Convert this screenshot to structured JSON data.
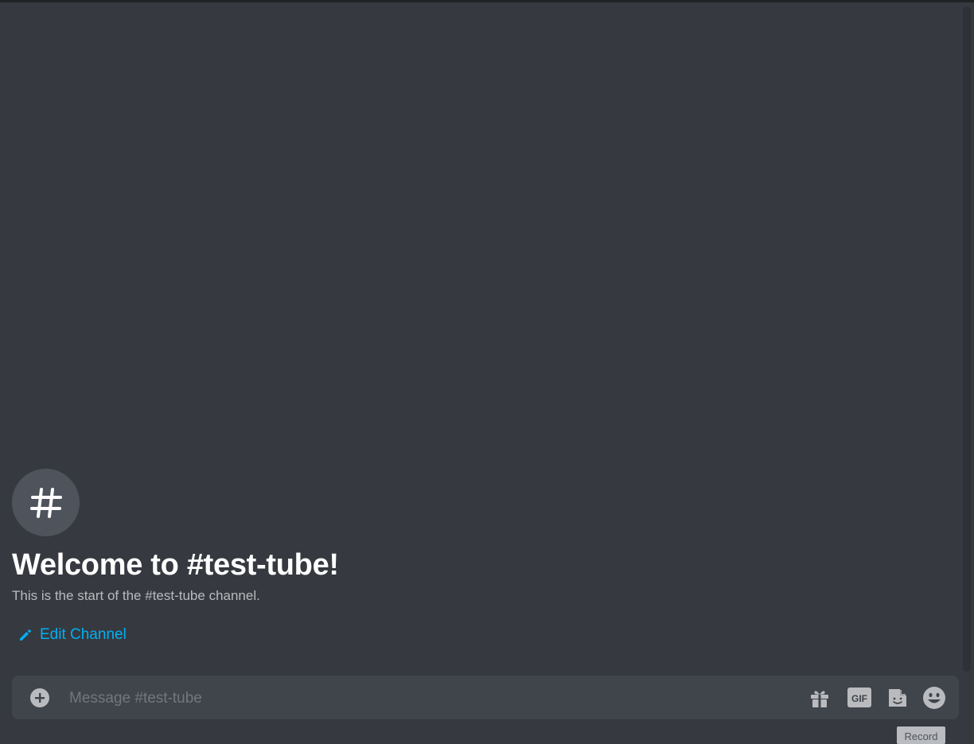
{
  "channel": {
    "name": "#test-tube",
    "welcome_title": "Welcome to #test-tube!",
    "welcome_subtitle": "This is the start of the #test-tube channel.",
    "edit_label": "Edit Channel"
  },
  "composer": {
    "placeholder": "Message #test-tube",
    "value": ""
  },
  "icons": {
    "channel": "hash-icon",
    "edit": "pencil-icon",
    "attach": "plus-circle-icon",
    "gift": "gift-icon",
    "gif": "gif-icon",
    "sticker": "sticker-icon",
    "emoji": "emoji-icon"
  },
  "gif_label": "GIF",
  "tooltip": {
    "label": "Record"
  },
  "colors": {
    "background": "#36393f",
    "composer": "#40444b",
    "link": "#00b0f4",
    "title": "#ffffff",
    "subtitle": "#b9bbbe",
    "icon": "#b9bbbe"
  }
}
